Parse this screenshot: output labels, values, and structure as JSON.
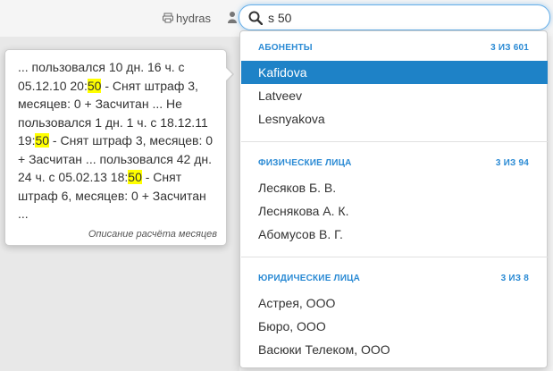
{
  "header": {
    "user_name": "hydras",
    "search": {
      "value": "s 50"
    }
  },
  "popover": {
    "segments": [
      {
        "text": "... пользовался 10 дн. 16 ч. с 05.12.10 20:",
        "hl": false
      },
      {
        "text": "50",
        "hl": true
      },
      {
        "text": " - Снят штраф 3, месяцев: 0 + Засчитан ... Не пользовался 1 дн. 1 ч. с 18.12.11 19:",
        "hl": false
      },
      {
        "text": "50",
        "hl": true
      },
      {
        "text": " - Снят штраф 3, месяцев: 0 + Засчитан ... пользовался 42 дн. 24 ч. с 05.02.13 18:",
        "hl": false
      },
      {
        "text": "50",
        "hl": true
      },
      {
        "text": " - Снят штраф 6, месяцев: 0 + Засчитан ...",
        "hl": false
      }
    ],
    "caption": "Описание расчёта месяцев"
  },
  "dropdown": {
    "sections": [
      {
        "title": "АБОНЕНТЫ",
        "count": "3 ИЗ 601",
        "items": [
          "Kafidova",
          "Latveev",
          "Lesnyakova"
        ],
        "active_index": 0
      },
      {
        "title": "ФИЗИЧЕСКИЕ ЛИЦА",
        "count": "3 ИЗ 94",
        "items": [
          "Лесяков Б. В.",
          "Леснякова А. К.",
          "Абомусов В. Г."
        ],
        "active_index": -1
      },
      {
        "title": "ЮРИДИЧЕСКИЕ ЛИЦА",
        "count": "3 ИЗ 8",
        "items": [
          "Астрея, ООО",
          "Бюро, ООО",
          "Васюки Телеком, ООО"
        ],
        "active_index": -1
      }
    ]
  },
  "colors": {
    "accent": "#1e82c7",
    "section_title": "#2a8ad4",
    "highlight": "#ffff00"
  },
  "icons": {
    "printer": "printer-icon",
    "person": "person-icon",
    "search": "search-icon"
  }
}
